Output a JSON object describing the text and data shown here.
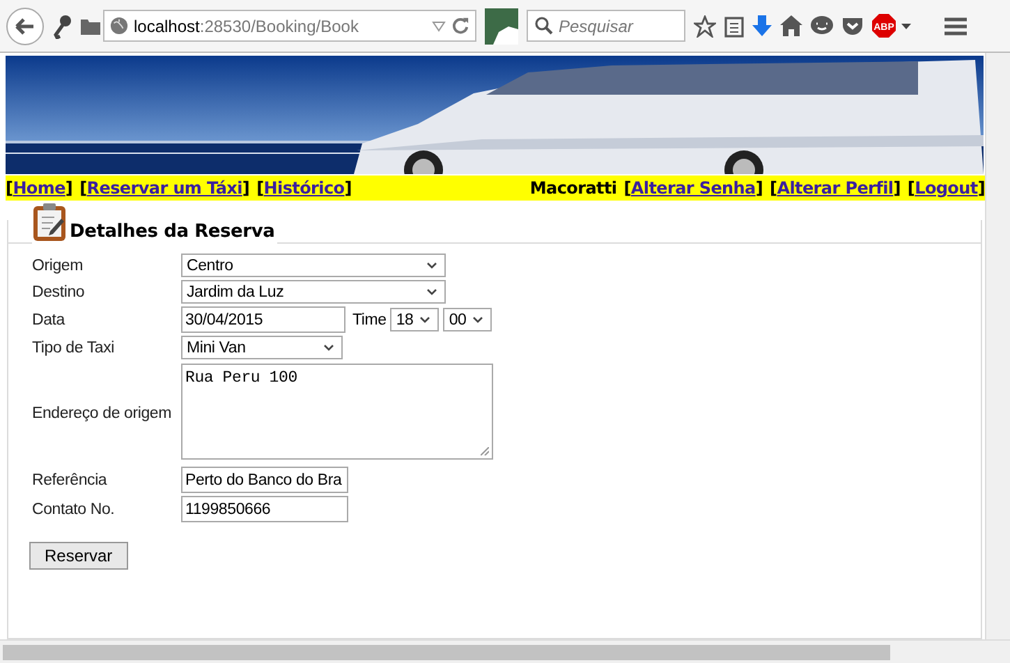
{
  "browser": {
    "url_host": "localhost",
    "url_path": ":28530/Booking/Book",
    "search_placeholder": "Pesquisar",
    "addon_badge": "ABP"
  },
  "nav": {
    "links": [
      {
        "open": "[",
        "label": "Home",
        "close": "]"
      },
      {
        "open": "[",
        "label": "Reservar um Táxi",
        "close": "]"
      },
      {
        "open": "[",
        "label": "Histórico",
        "close": "]"
      }
    ],
    "user": "Macoratti",
    "user_links": [
      {
        "open": "[",
        "label": "Alterar Senha",
        "close": "]"
      },
      {
        "open": "[",
        "label": "Alterar Perfil",
        "close": "]"
      },
      {
        "open": "[",
        "label": "Logout",
        "close": "]"
      }
    ]
  },
  "form": {
    "title": "Detalhes da Reserva",
    "fields": [
      {
        "kind": "select",
        "label": "Origem",
        "value": "Centro"
      },
      {
        "kind": "select",
        "label": "Destino",
        "value": "Jardim da Luz"
      },
      {
        "kind": "datetime",
        "label": "Data",
        "value": "30/04/2015",
        "time_label": "Time",
        "hour": "18",
        "minute": "00"
      },
      {
        "kind": "select-short",
        "label": "Tipo de Taxi",
        "value": "Mini Van"
      },
      {
        "kind": "textarea",
        "label": "Endereço de origem",
        "value": "Rua Peru 100"
      },
      {
        "kind": "text",
        "label": "Referência",
        "value": "Perto do Banco do Bra"
      },
      {
        "kind": "text",
        "label": "Contato No.",
        "value": "1199850666"
      }
    ],
    "submit": "Reservar"
  }
}
